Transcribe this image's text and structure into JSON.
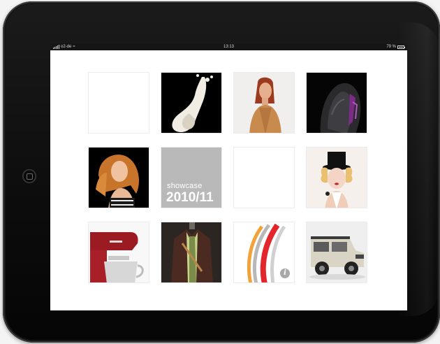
{
  "status_bar": {
    "carrier": "o2-de",
    "wifi_icon": "wifi-icon",
    "time": "13:13",
    "battery": "79 %"
  },
  "grid": {
    "tiles": [
      {
        "name": "tile-empty-1",
        "kind": "blank"
      },
      {
        "name": "tile-milk-splash",
        "kind": "photo"
      },
      {
        "name": "tile-woman-portrait",
        "kind": "photo"
      },
      {
        "name": "tile-fur-texture",
        "kind": "photo"
      },
      {
        "name": "tile-redhead-model",
        "kind": "photo"
      },
      {
        "name": "tile-showcase",
        "kind": "label",
        "label": "showcase",
        "year": "2010/11"
      },
      {
        "name": "tile-empty-2",
        "kind": "blank"
      },
      {
        "name": "tile-top-hat-model",
        "kind": "photo"
      },
      {
        "name": "tile-stand-mixer",
        "kind": "photo"
      },
      {
        "name": "tile-jacket",
        "kind": "photo"
      },
      {
        "name": "tile-logo-info",
        "kind": "logo",
        "icon": "info-icon",
        "info_glyph": "i"
      },
      {
        "name": "tile-offroad-vehicle",
        "kind": "photo"
      }
    ]
  },
  "colors": {
    "screen_bg": "#ffffff",
    "showcase_tile": "#b9b9b9",
    "logo_red": "#e3262b",
    "logo_gray": "#b8b8b8",
    "logo_orange": "#f2a23a"
  }
}
